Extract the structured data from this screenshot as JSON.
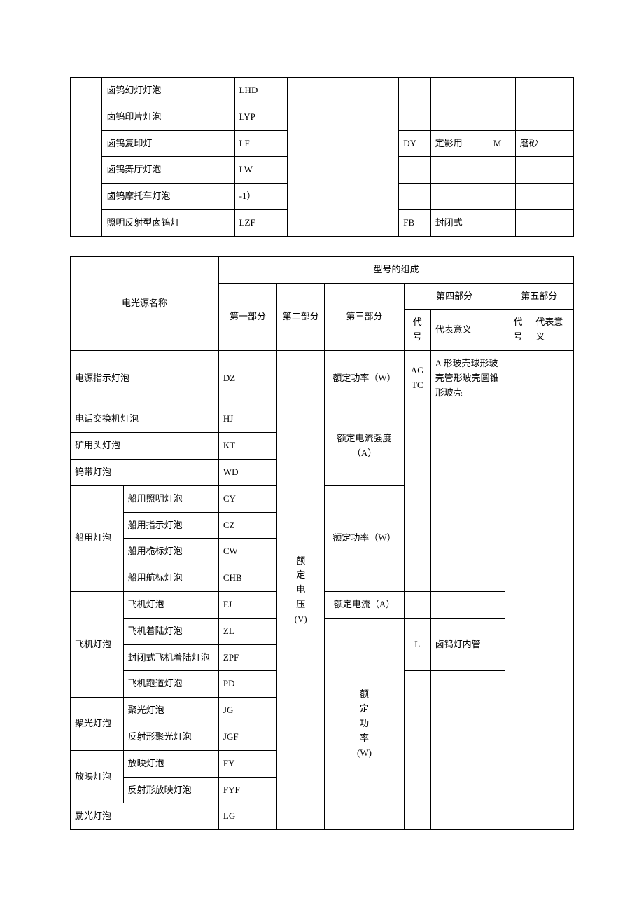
{
  "table1": {
    "rows": [
      {
        "name": "卤钨幻灯灯泡",
        "code": "LHD",
        "c4code": "",
        "c4mean": "",
        "c5code": "",
        "c5mean": ""
      },
      {
        "name": "卤钨印片灯泡",
        "code": "LYP",
        "c4code": "",
        "c4mean": "",
        "c5code": "",
        "c5mean": ""
      },
      {
        "name": "卤钨复印灯",
        "code": "LF",
        "c4code": "DY",
        "c4mean": "定影用",
        "c5code": "M",
        "c5mean": "磨砂"
      },
      {
        "name": "卤钨舞厅灯泡",
        "code": "LW",
        "c4code": "",
        "c4mean": "",
        "c5code": "",
        "c5mean": ""
      },
      {
        "name": "卤钨摩托车灯泡",
        "code": "-1）",
        "c4code": "",
        "c4mean": "",
        "c5code": "",
        "c5mean": ""
      },
      {
        "name": "照明反射型卤钨灯",
        "code": "LZF",
        "c4code": "FB",
        "c4mean": "封闭式",
        "c5code": "",
        "c5mean": ""
      }
    ]
  },
  "table2": {
    "headers": {
      "nameHeader": "电光源名称",
      "compHeader": "型号的组成",
      "p1": "第一部分",
      "p2": "第二部分",
      "p3": "第三部分",
      "p4": "第四部分",
      "p5": "第五部分",
      "codeLabel": "代号",
      "meanLabel": "代表意义",
      "meanLabel2": "代表意义"
    },
    "part2Label": "额定电压（V）",
    "part2LabelLines": [
      "额",
      "定",
      "电",
      "压",
      "(V)"
    ],
    "rows": [
      {
        "catSpan": 1,
        "cat": "电源指示灯泡",
        "sub": "",
        "noSub": true,
        "code": "DZ",
        "p3": "额定功率（W）",
        "p3rows": 1,
        "p4code": "A G T C",
        "p4codeLines": [
          "A",
          "G",
          "T",
          "C"
        ],
        "p4mean": "A形玻壳 球形玻壳 管形玻壳 圆锥形玻壳",
        "p4meanLines": [
          "A 形玻壳",
          "球形玻壳",
          "管形玻壳",
          "圆锥形玻壳"
        ],
        "p4rows": 1,
        "p5code": "",
        "p5mean": "",
        "p5rows": 14
      },
      {
        "cat": "电话交换机灯泡",
        "noSub": true,
        "code": "HJ",
        "p3": "额定电流强度（A）",
        "p3rows": 3,
        "p4code": "",
        "p4mean": "",
        "p4rows": 7
      },
      {
        "cat": "矿用头灯泡",
        "noSub": true,
        "code": "KT"
      },
      {
        "cat": "钨带灯泡",
        "noSub": true,
        "code": "WD"
      },
      {
        "cat": "船用灯泡",
        "catSpan": 4,
        "sub": "船用照明灯泡",
        "code": "CY",
        "p3": "额定功率（W）",
        "p3rows": 4
      },
      {
        "sub": "船用指示灯泡",
        "code": "CZ"
      },
      {
        "sub": "船用桅标灯泡",
        "code": "CW"
      },
      {
        "sub": "船用航标灯泡",
        "code": "CHB"
      },
      {
        "cat": "飞机灯泡",
        "catSpan": 4,
        "sub": "飞机灯泡",
        "code": "FJ",
        "p3": "额定电流（A）",
        "p3rows": 1,
        "p4code": "",
        "p4mean": "",
        "p4rows": 1
      },
      {
        "sub": "飞机着陆灯泡",
        "code": "ZL",
        "p3": "额定功率（W）",
        "p3rows": 8,
        "p4code": "L",
        "p4mean": "卤钨灯内管",
        "p4rows": 2
      },
      {
        "sub": "封闭式飞机着陆灯泡",
        "code": "ZPF"
      },
      {
        "sub": "飞机跑道灯泡",
        "code": "PD",
        "p4code": "",
        "p4mean": "",
        "p4rows": 6
      },
      {
        "cat": "聚光灯泡",
        "catSpan": 2,
        "sub": "聚光灯泡",
        "code": "JG"
      },
      {
        "sub": "反射形聚光灯泡",
        "code": "JGF"
      },
      {
        "cat": "放映灯泡",
        "catSpan": 2,
        "sub": "放映灯泡",
        "code": "FY"
      },
      {
        "sub": "反射形放映灯泡",
        "code": "FYF"
      },
      {
        "cat": "励光灯泡",
        "noSub": true,
        "code": "LG"
      }
    ],
    "p3labels": {
      "ratedPowerW": "额定功率（W）",
      "ratedPowerW_lines": [
        "额定功率",
        "（W）"
      ],
      "ratedCurrentStrengthA": "额定电流强度（A）",
      "ratedCurrentStrengthA_lines": [
        "额定电流强度",
        "（A）"
      ],
      "ratedCurrentA": "额定电流（A）",
      "ratedCurrentA_lines": [
        "额定电流",
        "（A）"
      ],
      "ratedPowerW_vert": [
        "额",
        "定",
        "功",
        "率",
        "(W)"
      ]
    }
  }
}
